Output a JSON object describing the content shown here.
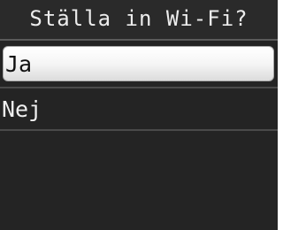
{
  "screen": {
    "title": "Ställa in Wi-Fi?"
  },
  "menu": {
    "items": [
      {
        "label": "Ja",
        "selected": true
      },
      {
        "label": "Nej",
        "selected": false
      }
    ]
  },
  "colors": {
    "background": "#242424",
    "text": "#ececec",
    "selected_background": "#f2f2f2",
    "selected_text": "#111111"
  }
}
